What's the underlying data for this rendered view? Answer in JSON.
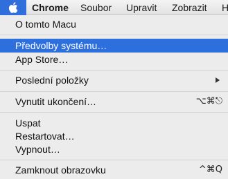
{
  "menubar": {
    "apple_icon": "apple-logo-icon",
    "items": [
      {
        "label": "Chrome"
      },
      {
        "label": "Soubor"
      },
      {
        "label": "Upravit"
      },
      {
        "label": "Zobrazit"
      },
      {
        "label": "H"
      }
    ]
  },
  "apple_menu": {
    "items": [
      {
        "label": "O tomto Macu"
      },
      {
        "label": "Předvolby systému…",
        "highlighted": true
      },
      {
        "label": "App Store…"
      },
      {
        "label": "Poslední položky",
        "submenu_icon": "chevron-right-icon"
      },
      {
        "label": "Vynutit ukončení…",
        "shortcut": "⌥⌘⎋"
      },
      {
        "label": "Uspat"
      },
      {
        "label": "Restartovat…"
      },
      {
        "label": "Vypnout…"
      },
      {
        "label": "Zamknout obrazovku",
        "shortcut": "^⌘Q"
      }
    ]
  },
  "colors": {
    "highlight": "#2e6fde",
    "menu_background": "#ececec",
    "separator": "#d2d2d2"
  }
}
